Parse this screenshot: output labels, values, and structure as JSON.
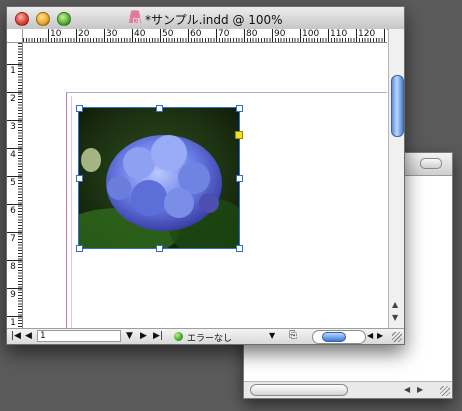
{
  "window": {
    "title": "*サンプル.indd @ 100%",
    "zoom": "100%"
  },
  "rulers": {
    "horizontal": [
      "10",
      "20",
      "30",
      "40",
      "50",
      "60",
      "70",
      "80",
      "90",
      "100",
      "110",
      "120",
      "13"
    ],
    "vertical": [
      "1",
      "2",
      "3",
      "4",
      "5",
      "6",
      "7",
      "8",
      "9",
      "1"
    ]
  },
  "statusbar": {
    "page_number": "1",
    "status_text": "エラーなし",
    "status_color": "#2f9a16"
  },
  "icons": {
    "close": "close-icon",
    "minimize": "minimize-icon",
    "zoom": "zoom-icon",
    "document": "indd-document-icon",
    "first_page": "first-page-icon",
    "prev_page": "prev-page-icon",
    "next_page": "next-page-icon",
    "last_page": "last-page-icon",
    "preflight": "preflight-icon"
  },
  "colors": {
    "frame_selection": "#2f6fd0",
    "page_border": "#c07aa8",
    "scroll_accent": "#5d8ed6"
  }
}
